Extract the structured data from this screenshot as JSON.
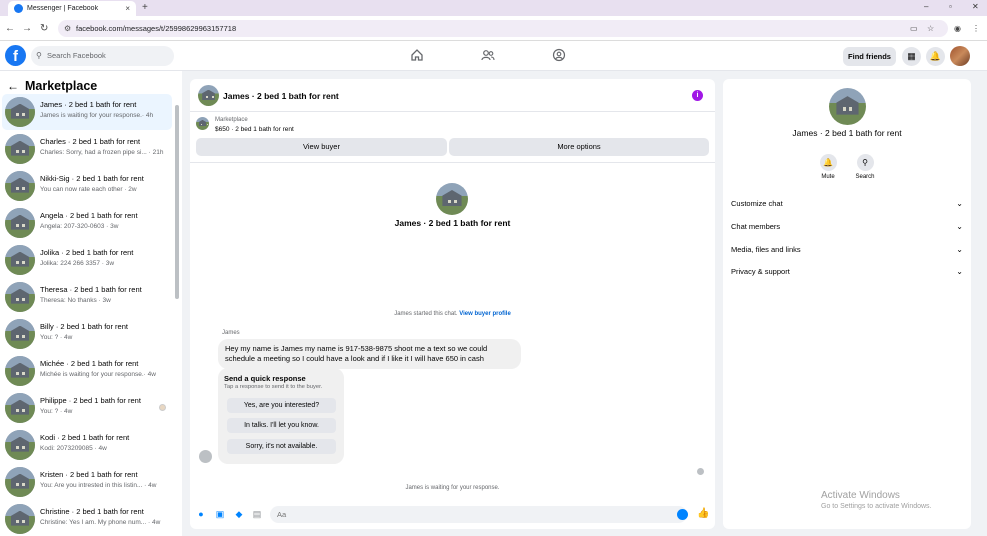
{
  "browser": {
    "tab_title": "Messenger | Facebook",
    "tab_close": "×",
    "new_tab": "+",
    "url": "facebook.com/messages/t/25998629963157718",
    "win_min": "–",
    "win_max": "▫",
    "win_close": "✕"
  },
  "header": {
    "logo": "f",
    "search_placeholder": "Search Facebook",
    "find_friends": "Find friends"
  },
  "sidebar": {
    "title": "Marketplace",
    "conversations": [
      {
        "name": "James · 2 bed 1 bath for rent",
        "preview": "James is waiting for your response.· 4h"
      },
      {
        "name": "Charles · 2 bed 1 bath for rent",
        "preview": "Charles: Sorry, had a frozen pipe si... · 21h"
      },
      {
        "name": "Nikki-Sig · 2 bed 1 bath for rent",
        "preview": "You can now rate each other · 2w"
      },
      {
        "name": "Angela · 2 bed 1 bath for rent",
        "preview": "Angela: 207-320-0603 · 3w"
      },
      {
        "name": "Jolika · 2 bed 1 bath for rent",
        "preview": "Jolika: 224 266 3357 · 3w"
      },
      {
        "name": "Theresa · 2 bed 1 bath for rent",
        "preview": "Theresa: No thanks · 3w"
      },
      {
        "name": "Billy · 2 bed 1 bath for rent",
        "preview": "You: ? · 4w"
      },
      {
        "name": "Michée · 2 bed 1 bath for rent",
        "preview": "Michée is waiting for your response.· 4w"
      },
      {
        "name": "Philippe · 2 bed 1 bath for rent",
        "preview": "You: ? · 4w"
      },
      {
        "name": "Kodi · 2 bed 1 bath for rent",
        "preview": "Kodi: 2073209085 · 4w"
      },
      {
        "name": "Kristen · 2 bed 1 bath for rent",
        "preview": "You: Are you intrested in this listin... · 4w"
      },
      {
        "name": "Christine · 2 bed 1 bath for rent",
        "preview": "Christine: Yes I am. My phone num... · 4w"
      }
    ]
  },
  "chat": {
    "title": "James · 2 bed 1 bath for rent",
    "marketplace_label": "Marketplace",
    "listing_price": "$650 · 2 bed 1 bath for rent",
    "view_buyer": "View buyer",
    "more_options": "More options",
    "intro_title": "James · 2 bed 1 bath for rent",
    "started_text": "James started this chat.",
    "view_buyer_profile": "View buyer profile",
    "sender": "James",
    "message": "Hey my name is James my name is 917-538-9875 shoot me a text so we could schedule a meeting so I could have a look and if I like it I will have 650 in cash",
    "quick_response_title": "Send a quick response",
    "quick_response_sub": "Tap a response to send it to the buyer.",
    "quick_responses": [
      "Yes, are you interested?",
      "In talks. I'll let you know.",
      "Sorry, it's not available."
    ],
    "waiting": "James is waiting for your response.",
    "input_placeholder": "Aa"
  },
  "right_panel": {
    "title": "James · 2 bed 1 bath for rent",
    "mute": "Mute",
    "search": "Search",
    "sections": [
      "Customize chat",
      "Chat members",
      "Media, files and links",
      "Privacy & support"
    ]
  },
  "watermark": {
    "line1": "Activate Windows",
    "line2": "Go to Settings to activate Windows."
  }
}
